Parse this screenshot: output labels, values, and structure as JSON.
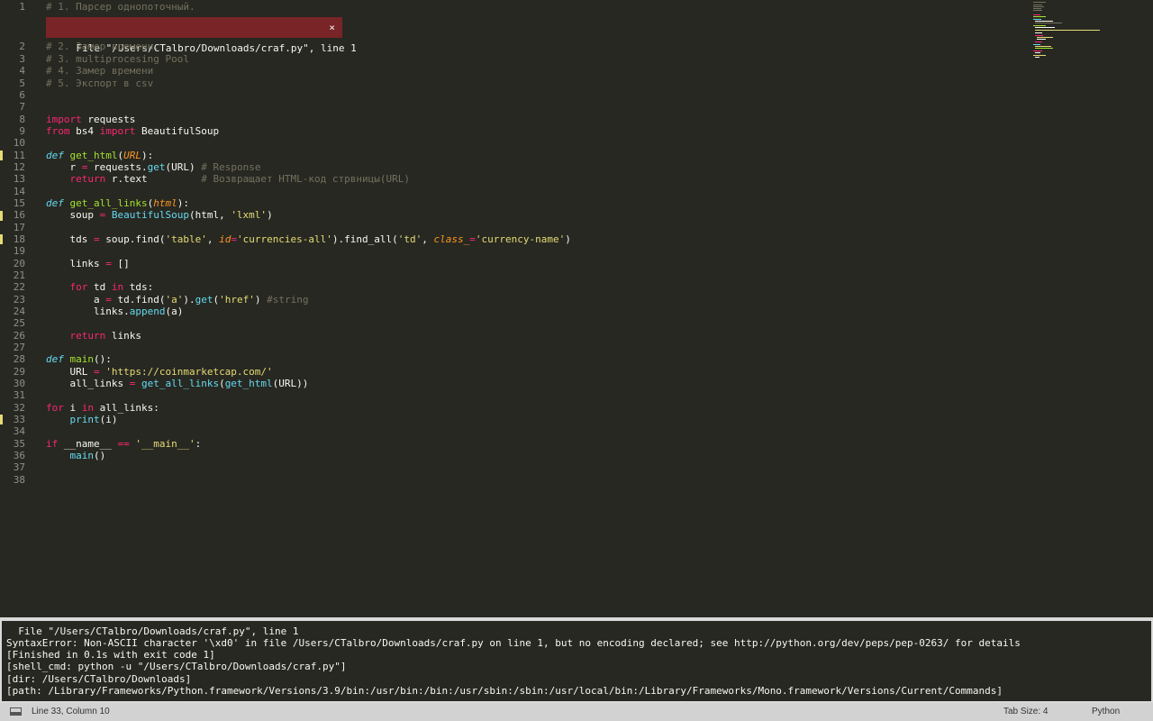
{
  "editor": {
    "line_numbers": [
      "1",
      "2",
      "3",
      "4",
      "5",
      "6",
      "7",
      "8",
      "9",
      "10",
      "11",
      "12",
      "13",
      "14",
      "15",
      "16",
      "17",
      "18",
      "19",
      "20",
      "21",
      "22",
      "23",
      "24",
      "25",
      "26",
      "27",
      "28",
      "29",
      "30",
      "31",
      "32",
      "33",
      "34",
      "35",
      "36",
      "37",
      "38"
    ],
    "error_phantom": {
      "text": "File \"/Users/CTalbro/Downloads/craf.py\", line 1",
      "close_glyph": "×"
    },
    "lines": {
      "l1": {
        "c": "# 1. Парсер однопоточный."
      },
      "l2": {
        "c": "# 2. Замер времени."
      },
      "l3": {
        "c": "# 3. multiprocesing Pool"
      },
      "l4": {
        "c": "# 4. Замер времени"
      },
      "l5": {
        "c": "# 5. Экспорт в csv"
      },
      "l8": {
        "k": "import",
        "t": " requests"
      },
      "l9": {
        "k1": "from",
        "t1": " bs4 ",
        "k2": "import",
        "t2": " BeautifulSoup"
      },
      "l11": {
        "d": "def",
        "t1": " ",
        "f": "get_html",
        "t2": "(",
        "p": "URL",
        "t3": "):"
      },
      "l12": {
        "t1": "    r ",
        "o": "=",
        "t2": " requests.",
        "b": "get",
        "t3": "(URL) ",
        "c": "# Response"
      },
      "l13": {
        "k": "    return",
        "t": " r.text         ",
        "c": "# Возвращает HTML-код стрвницы(URL)"
      },
      "l15": {
        "d": "def",
        "t1": " ",
        "f": "get_all_links",
        "t2": "(",
        "p": "html",
        "t3": "):"
      },
      "l16": {
        "t1": "    soup ",
        "o": "=",
        "t2": " ",
        "b": "BeautifulSoup",
        "t3": "(html, ",
        "s": "'lxml'",
        "t4": ")"
      },
      "l18": {
        "t1": "    tds ",
        "o": "=",
        "t2": " soup.find(",
        "s1": "'table'",
        "t3": ", ",
        "p1": "id",
        "o2": "=",
        "s2": "'currencies-all'",
        "t4": ").find_all(",
        "s3": "'td'",
        "t5": ", ",
        "p2": "class_",
        "o3": "=",
        "s4": "'currency-name'",
        "t6": ")"
      },
      "l20": {
        "t1": "    links ",
        "o": "=",
        "t2": " []"
      },
      "l22": {
        "k1": "    for",
        "t1": " td ",
        "k2": "in",
        "t2": " tds:"
      },
      "l23": {
        "t1": "        a ",
        "o": "=",
        "t2": " td.find(",
        "s1": "'a'",
        "t3": ").",
        "b": "get",
        "t4": "(",
        "s2": "'href'",
        "t5": ") ",
        "c": "#string"
      },
      "l24": {
        "t1": "        links.",
        "b": "append",
        "t2": "(a)"
      },
      "l26": {
        "k": "    return",
        "t": " links"
      },
      "l28": {
        "d": "def",
        "t1": " ",
        "f": "main",
        "t2": "():"
      },
      "l29": {
        "t1": "    URL ",
        "o": "=",
        "t2": " ",
        "s": "'https://coinmarketcap.com/'"
      },
      "l30": {
        "t1": "    all_links ",
        "o": "=",
        "t2": " ",
        "b1": "get_all_links",
        "t3": "(",
        "b2": "get_html",
        "t4": "(URL))"
      },
      "l32": {
        "k1": "for",
        "t1": " i ",
        "k2": "in",
        "t2": " all_links:"
      },
      "l33": {
        "t1": "    ",
        "b": "print",
        "t2": "(i)"
      },
      "l35": {
        "k": "if",
        "t1": " __name__ ",
        "o": "==",
        "t2": " ",
        "s": "'__main__'",
        "t3": ":"
      },
      "l36": {
        "t1": "    ",
        "b": "main",
        "t2": "()"
      }
    }
  },
  "output": {
    "lines": [
      "  File \"/Users/CTalbro/Downloads/craf.py\", line 1",
      "SyntaxError: Non-ASCII character '\\xd0' in file /Users/CTalbro/Downloads/craf.py on line 1, but no encoding declared; see http://python.org/dev/peps/pep-0263/ for details",
      "[Finished in 0.1s with exit code 1]",
      "[shell_cmd: python -u \"/Users/CTalbro/Downloads/craf.py\"]",
      "[dir: /Users/CTalbro/Downloads]",
      "[path: /Library/Frameworks/Python.framework/Versions/3.9/bin:/usr/bin:/bin:/usr/sbin:/sbin:/usr/local/bin:/Library/Frameworks/Mono.framework/Versions/Current/Commands]"
    ]
  },
  "status": {
    "position": "Line 33, Column 10",
    "tab_size": "Tab Size: 4",
    "syntax": "Python"
  },
  "colors": {
    "background": "#272822",
    "keyword": "#f92672",
    "string": "#e6db74",
    "comment": "#75715e",
    "function": "#a6e22e",
    "parameter": "#fd971f",
    "storage": "#66d9ef",
    "error_phantom": "#792426",
    "gutter_marker": "#e6db74"
  }
}
